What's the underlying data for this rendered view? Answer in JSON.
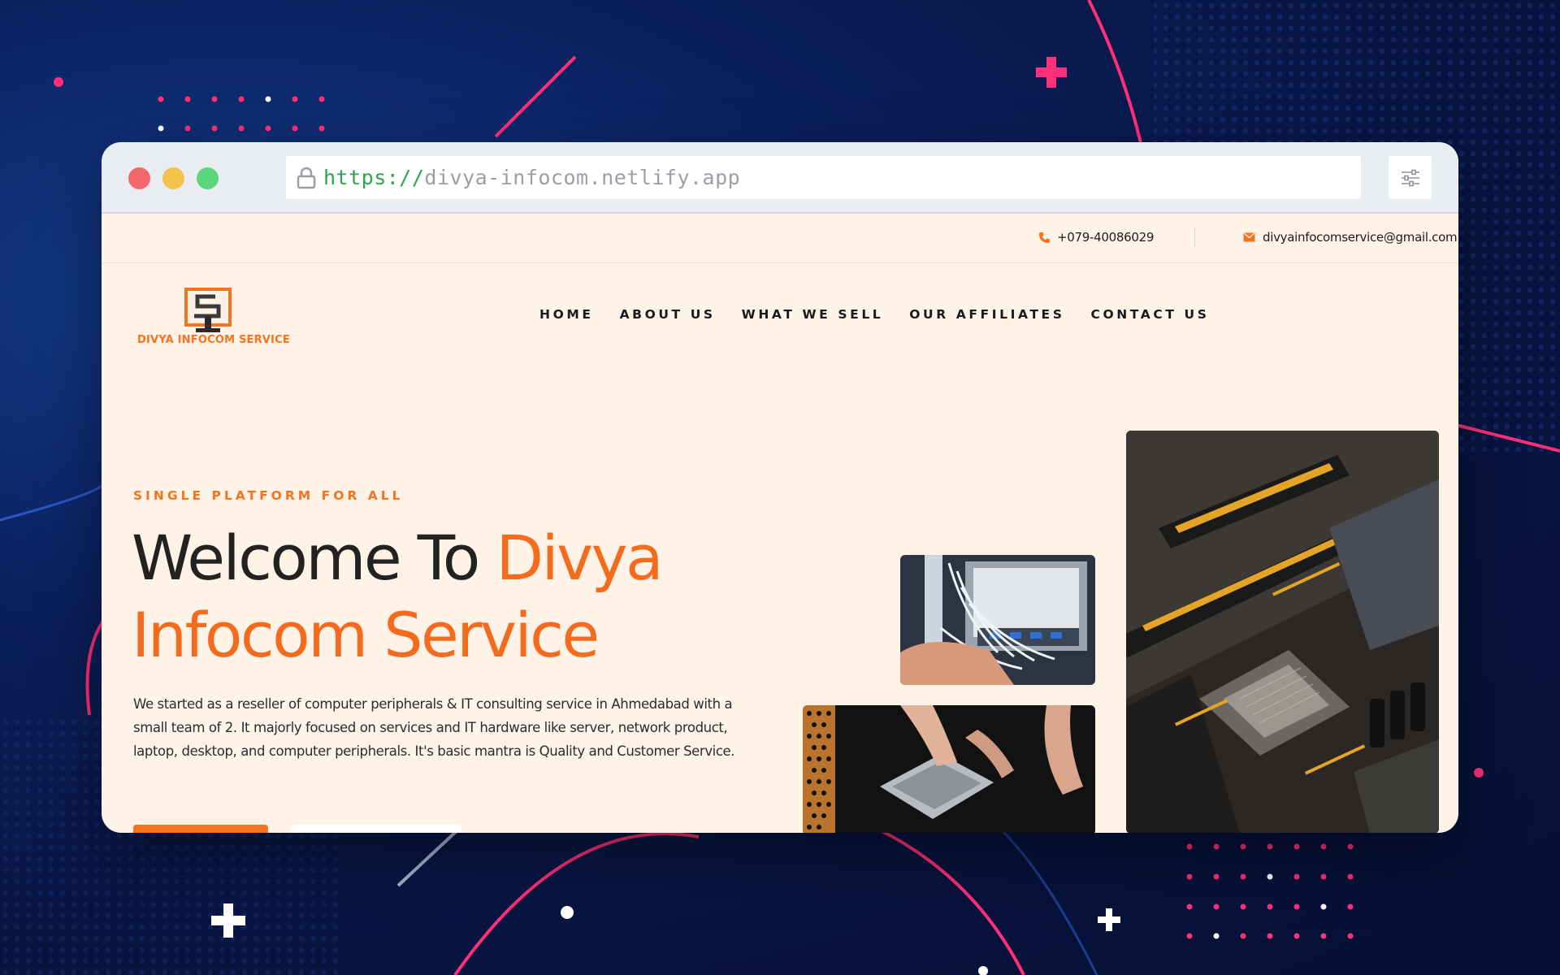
{
  "browser": {
    "url_scheme": "https://",
    "url_host": "divya-infocom.netlify.app"
  },
  "topbar": {
    "phone": "+079-40086029",
    "email": "divyainfocomservice@gmail.com"
  },
  "logo": {
    "text": "DIVYA INFOCOM SERVICE"
  },
  "nav": {
    "items": [
      {
        "label": "HOME"
      },
      {
        "label": "ABOUT US"
      },
      {
        "label": "WHAT WE SELL"
      },
      {
        "label": "OUR AFFILIATES"
      },
      {
        "label": "CONTACT US"
      }
    ]
  },
  "hero": {
    "eyebrow": "SINGLE PLATFORM FOR ALL",
    "title_plain": "Welcome To ",
    "title_accent": "Divya Infocom Service",
    "description": "We started as a reseller of computer peripherals & IT consulting service in Ahmedabad with a small team of 2. It majorly focused on services and IT hardware like server, network product, laptop, desktop, and computer peripherals. It's basic mantra is Quality and Customer Service."
  },
  "colors": {
    "accent": "#f47320",
    "page_bg": "#fff3e8",
    "backdrop": "#07143f",
    "pink": "#ff2f7a"
  }
}
